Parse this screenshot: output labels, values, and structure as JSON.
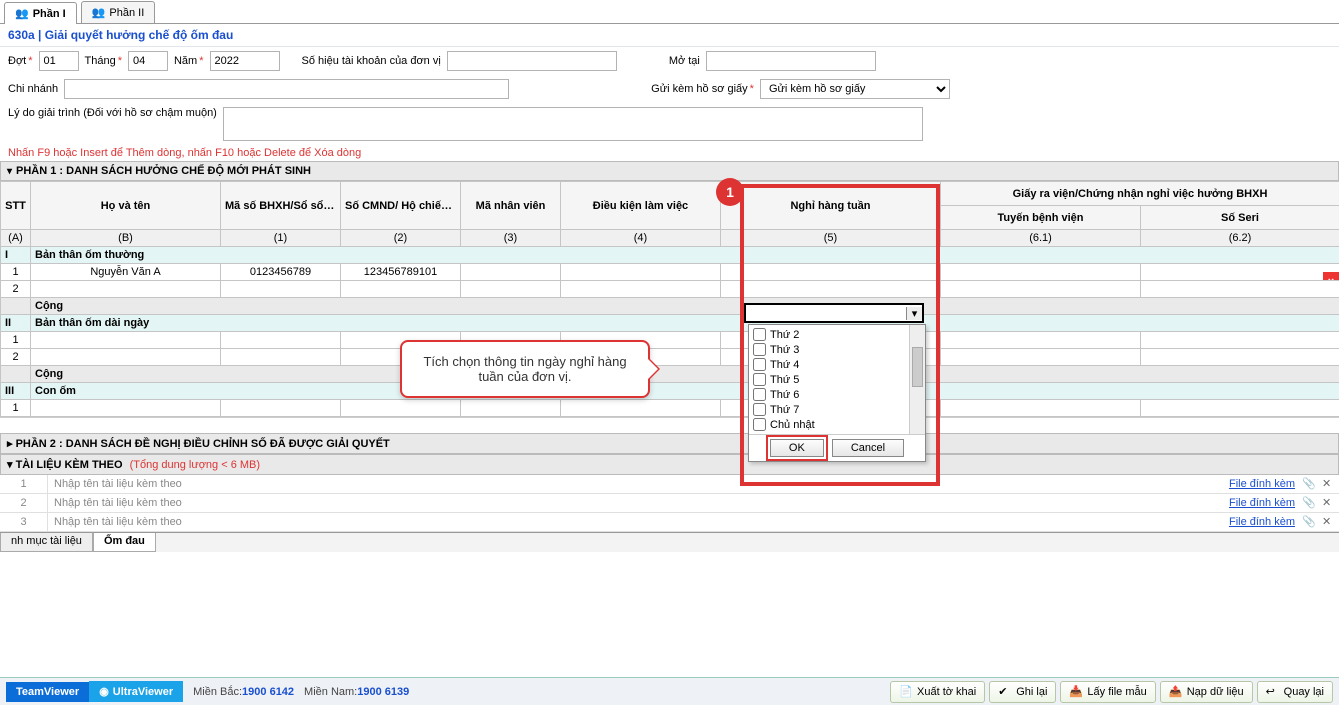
{
  "top_tabs": {
    "phan1": "Phần I",
    "phan2": "Phần II"
  },
  "title": "630a | Giải quyết hưởng chế độ ốm đau",
  "form": {
    "dot_label": "Đợt",
    "dot_value": "01",
    "thang_label": "Tháng",
    "thang_value": "04",
    "nam_label": "Năm",
    "nam_value": "2022",
    "sohieu_label": "Số hiệu tài khoản của đơn vị",
    "sohieu_value": "",
    "motai_label": "Mở tại",
    "motai_value": "",
    "chinhanh_label": "Chi nhánh",
    "chinhanh_value": "",
    "guikem_label": "Gửi kèm hồ sơ giấy",
    "guikem_value": "Gửi kèm hồ sơ giấy",
    "lydo_label": "Lý do giải trình (Đối với hồ sơ chậm muộn)",
    "lydo_value": ""
  },
  "hint": "Nhấn F9 hoặc Insert để Thêm dòng, nhấn F10 hoặc Delete để Xóa dòng",
  "section1_title": "PHẦN 1 :  DANH SÁCH HƯỞNG CHẾ ĐỘ MỚI PHÁT SINH",
  "columns": {
    "stt": "STT",
    "hoten": "Họ và tên",
    "masobhxh": "Mã số BHXH/Sổ sổ BHXH",
    "cmnd": "Số CMND/ Hộ chiếu/Thẻ căn cước của NLĐ",
    "manv": "Mã nhân viên",
    "dklv": "Điều kiện làm việc",
    "nghituan": "Nghỉ hàng tuần",
    "giayra_group": "Giấy ra viện/Chứng nhận nghỉ việc hưởng BHXH",
    "tuyenbv": "Tuyến bệnh viện",
    "soseri": "Số Seri"
  },
  "col_codes": {
    "a": "(A)",
    "b": "(B)",
    "c1": "(1)",
    "c2": "(2)",
    "c3": "(3)",
    "c4": "(4)",
    "c5": "(5)",
    "c61": "(6.1)",
    "c62": "(6.2)"
  },
  "groups": {
    "g1_code": "I",
    "g1_label": "Bản thân ốm thường",
    "g2_code": "II",
    "g2_label": "Bản thân ốm dài ngày",
    "g3_code": "III",
    "g3_label": "Con ốm",
    "cong": "Cộng"
  },
  "row1": {
    "stt": "1",
    "name": "Nguyễn Văn A",
    "bhxh": "0123456789",
    "cmnd": "123456789101"
  },
  "callout": "Tích chọn thông tin ngày nghỉ hàng tuần của đơn vị.",
  "badge": "1",
  "dropdown": {
    "options": [
      "Thứ 2",
      "Thứ 3",
      "Thứ 4",
      "Thứ 5",
      "Thứ 6",
      "Thứ 7",
      "Chủ nhật"
    ],
    "ok": "OK",
    "cancel": "Cancel"
  },
  "section2_title": "PHẦN 2 : DANH SÁCH ĐỀ NGHỊ ĐIỀU CHỈNH SỐ ĐÃ ĐƯỢC GIẢI QUYẾT",
  "section3_title": "TÀI LIỆU KÈM THEO",
  "section3_sub": "(Tổng dung lượng < 6 MB)",
  "attachments": {
    "placeholder": "Nhập tên tài liệu kèm theo",
    "link": "File đính kèm",
    "rows": [
      "1",
      "2",
      "3"
    ]
  },
  "bottom_tabs": {
    "t1": "nh mục tài liệu",
    "t2": "Ốm đau"
  },
  "footer": {
    "teamviewer": "TeamViewer",
    "ultraviewer": "UltraViewer",
    "mb_label": "Miền Bắc:",
    "mb_num": "1900 6142",
    "mn_label": "Miền Nam:",
    "mn_num": "1900 6139",
    "btn_xuat": "Xuất tờ khai",
    "btn_ghi": "Ghi lại",
    "btn_lay": "Lấy file mẫu",
    "btn_nap": "Nạp dữ liệu",
    "btn_quay": "Quay lại"
  }
}
